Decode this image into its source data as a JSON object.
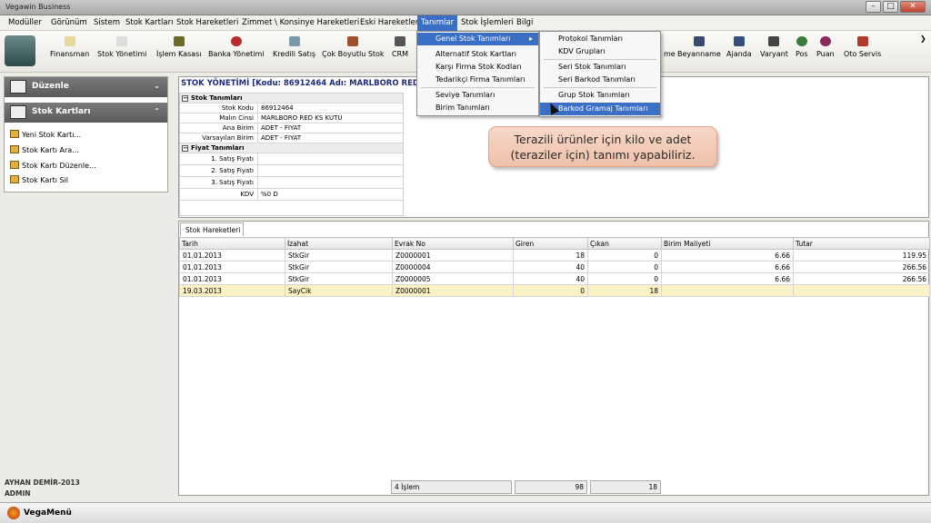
{
  "window": {
    "title": "Vegawin Business"
  },
  "menu": [
    "Modüller",
    "Görünüm",
    "Sistem",
    "Stok Kartları",
    "Stok Hareketleri",
    "Zimmet \\ Konsinye Hareketleri",
    "Eski Hareketler",
    "Tanımlar",
    "Stok İşlemleri",
    "Bilgi"
  ],
  "toolbar": [
    "Finansman",
    "Stok Yönetimi",
    "İşlem Kasası",
    "Banka Yönetimi",
    "Kredili Satış",
    "Çok Boyutlu Stok",
    "CRM",
    "me",
    "Beyanname",
    "Ajanda",
    "Varyant",
    "Pos",
    "Puan",
    "Oto Servis"
  ],
  "sidebar": {
    "duzenle": "Düzenle",
    "stok_kartlari": "Stok Kartları",
    "items": [
      "Yeni Stok Kartı...",
      "Stok Kartı Ara...",
      "Stok Kartı Düzenle...",
      "Stok Kartı Sil"
    ]
  },
  "user": {
    "name": "AYHAN DEMİR-2013",
    "role": "ADMIN"
  },
  "main": {
    "header": "STOK YÖNETİMİ [Kodu: 86912464 Adı: MARLBORO RED"
  },
  "props": {
    "sec1": "Stok Tanımları",
    "rows1": [
      {
        "k": "Stok Kodu",
        "v": "86912464"
      },
      {
        "k": "Malın Cinsi",
        "v": "MARLBORO RED KS KUTU"
      },
      {
        "k": "Ana Birim",
        "v": "ADET - FIYAT"
      },
      {
        "k": "Varsayılan Birim",
        "v": "ADET - FIYAT"
      }
    ],
    "sec2": "Fiyat Tanımları",
    "rows2": [
      {
        "k": "1. Satış Fiyatı",
        "v": ""
      },
      {
        "k": "2. Satış Fiyatı",
        "v": ""
      },
      {
        "k": "3. Satış Fiyatı",
        "v": ""
      },
      {
        "k": "KDV",
        "v": "%0 D"
      }
    ]
  },
  "callout": {
    "line1": "Terazili ürünler için kilo ve adet",
    "line2": "(teraziler için) tanımı yapabiliriz."
  },
  "tab": "Stok Hareketleri",
  "grid": {
    "columns": [
      "Tarih",
      "İzahat",
      "Evrak No",
      "Giren",
      "Çıkan",
      "Birim Maliyeti",
      "Tutar"
    ],
    "rows": [
      [
        "01.01.2013",
        "StkGir",
        "Z0000001",
        "18",
        "0",
        "6.66",
        "119.95"
      ],
      [
        "01.01.2013",
        "StkGir",
        "Z0000004",
        "40",
        "0",
        "6.66",
        "266.56"
      ],
      [
        "01.01.2013",
        "StkGir",
        "Z0000005",
        "40",
        "0",
        "6.66",
        "266.56"
      ],
      [
        "19.03.2013",
        "SayCik",
        "Z0000001",
        "0",
        "18",
        "",
        ""
      ]
    ]
  },
  "footer": {
    "count": "4 İşlem",
    "giren": "98",
    "cikan": "18"
  },
  "status": "VegaMenü",
  "dropdown1": [
    "Genel Stok Tanımları",
    "Alternatif Stok Kartları",
    "Karşı Firma Stok Kodları",
    "Tedarikçi Firma Tanımları",
    "Seviye Tanımları",
    "Birim Tanımları"
  ],
  "dropdown2": [
    "Protokol Tanımları",
    "KDV Grupları",
    "Seri Stok Tanımları",
    "Seri Barkod Tanımları",
    "Grup Stok Tanımları",
    "Barkod Gramaj Tanımları"
  ],
  "colors": {
    "accent": "#3b6fc5",
    "header_text": "#1d2b79",
    "highlight_row": "#fdf2c6"
  }
}
